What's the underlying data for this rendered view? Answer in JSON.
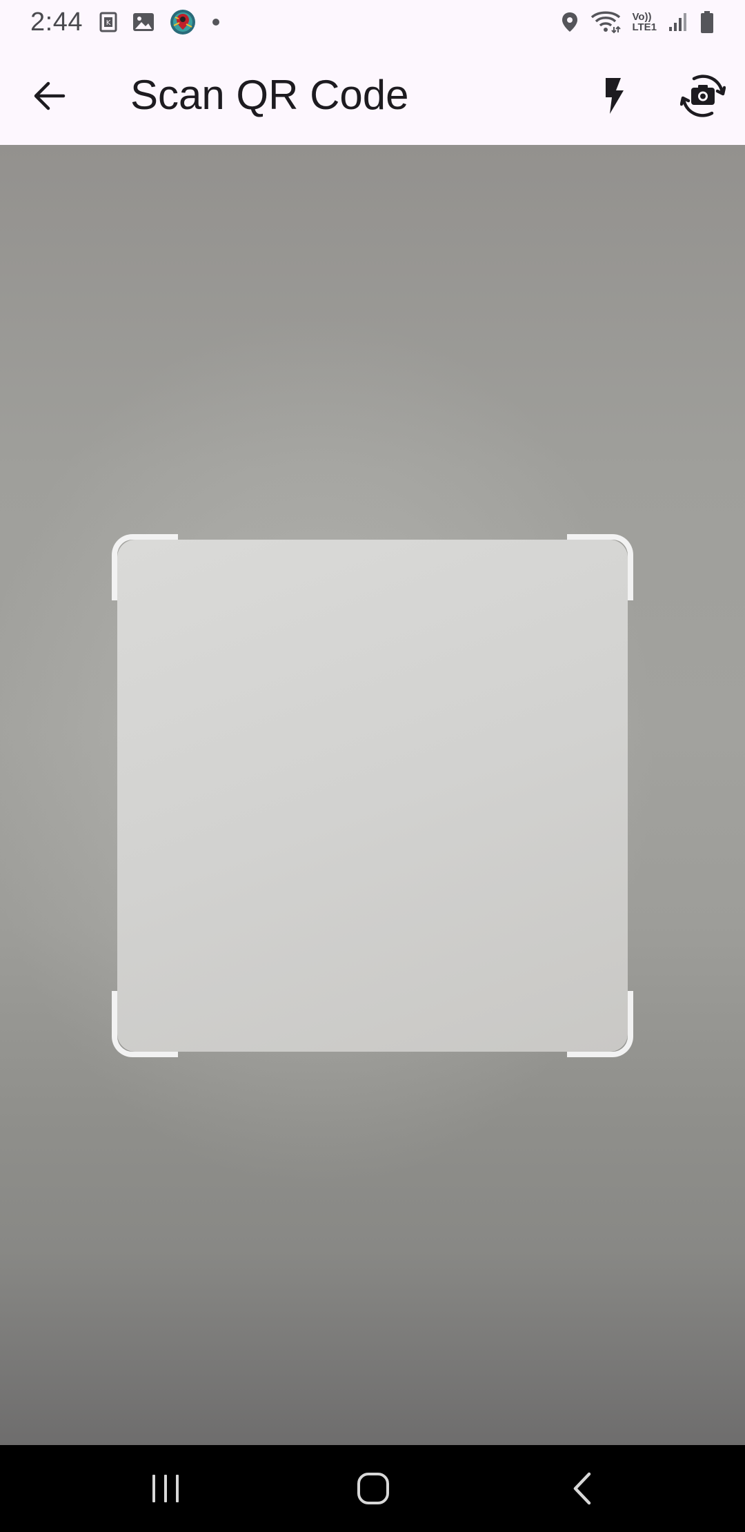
{
  "status_bar": {
    "time": "2:44",
    "network": {
      "line1": "Vo))",
      "line2": "LTE1"
    },
    "left_icons": [
      "k-app-icon",
      "gallery-icon",
      "app-notification-icon",
      "dot-icon"
    ],
    "right_icons": [
      "location-icon",
      "wifi-icon",
      "signal-icon",
      "battery-icon"
    ]
  },
  "app_bar": {
    "title": "Scan QR Code",
    "back_icon": "arrow-left-icon",
    "flash_icon": "flash-icon",
    "switch_camera_icon": "switch-camera-icon"
  },
  "scanner": {
    "frame_color": "#f2f2f2"
  },
  "nav_bar": {
    "icons": [
      "recent-apps-icon",
      "home-icon",
      "back-icon"
    ]
  },
  "colors": {
    "app_bar_bg": "#fdf7fe",
    "title_color": "#1d1b20",
    "nav_bg": "#000000"
  }
}
